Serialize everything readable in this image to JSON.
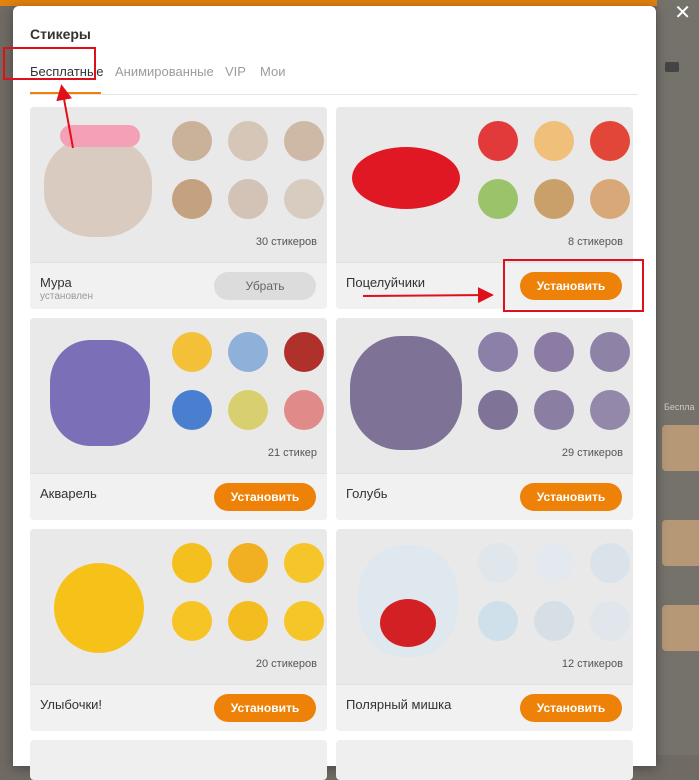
{
  "modal": {
    "title": "Стикеры",
    "close_icon": "close-icon"
  },
  "tabs": [
    {
      "label": "Бесплатные",
      "active": true
    },
    {
      "label": "Анимированные",
      "active": false
    },
    {
      "label": "VIP",
      "active": false
    },
    {
      "label": "Мои",
      "active": false
    }
  ],
  "packs": [
    {
      "name": "Мура",
      "status": "установлен",
      "count": "30 стикеров",
      "button": "Убрать"
    },
    {
      "name": "Поцелуйчики",
      "count": "8 стикеров",
      "button": "Установить"
    },
    {
      "name": "Акварель",
      "count": "21 стикер",
      "button": "Установить"
    },
    {
      "name": "Голубь",
      "count": "29 стикеров",
      "button": "Установить"
    },
    {
      "name": "Улыбочки!",
      "count": "20 стикеров",
      "button": "Установить"
    },
    {
      "name": "Полярный мишка",
      "count": "12 стикеров",
      "button": "Установить"
    }
  ],
  "background": {
    "side_label": "Беспла"
  },
  "colors": {
    "accent": "#ee8208",
    "annotation": "#e0101a"
  }
}
